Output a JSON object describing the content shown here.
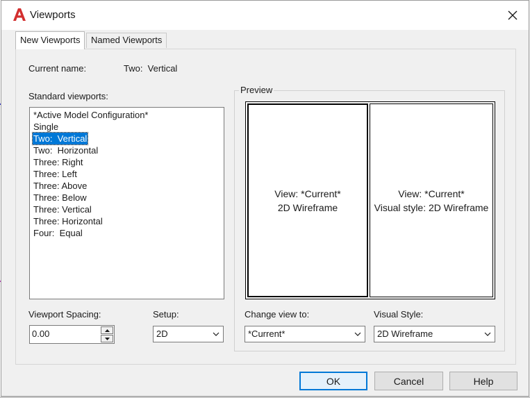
{
  "window": {
    "title": "Viewports",
    "accent": "#0078d7",
    "app_icon": "autocad-a-icon",
    "close_icon": "close-icon"
  },
  "tabs": [
    {
      "label": "New Viewports",
      "active": true
    },
    {
      "label": "Named Viewports",
      "active": false
    }
  ],
  "current_name": {
    "label": "Current name:",
    "value": "Two:  Vertical"
  },
  "standard_viewports": {
    "label": "Standard viewports:",
    "items": [
      "*Active Model Configuration*",
      "Single",
      "Two:  Vertical",
      "Two:  Horizontal",
      "Three: Right",
      "Three: Left",
      "Three: Above",
      "Three: Below",
      "Three: Vertical",
      "Three: Horizontal",
      "Four:  Equal"
    ],
    "selected_index": 2
  },
  "preview": {
    "label": "Preview",
    "left": {
      "line1": "View: *Current*",
      "line2": "2D Wireframe"
    },
    "right": {
      "line1": "View: *Current*",
      "line2": "Visual style: 2D Wireframe"
    }
  },
  "viewport_spacing": {
    "label": "Viewport Spacing:",
    "value": "0.00"
  },
  "setup": {
    "label": "Setup:",
    "value": "2D"
  },
  "change_view": {
    "label": "Change view to:",
    "value": "*Current*"
  },
  "visual_style": {
    "label": "Visual Style:",
    "value": "2D Wireframe"
  },
  "buttons": {
    "ok": "OK",
    "cancel": "Cancel",
    "help": "Help"
  }
}
